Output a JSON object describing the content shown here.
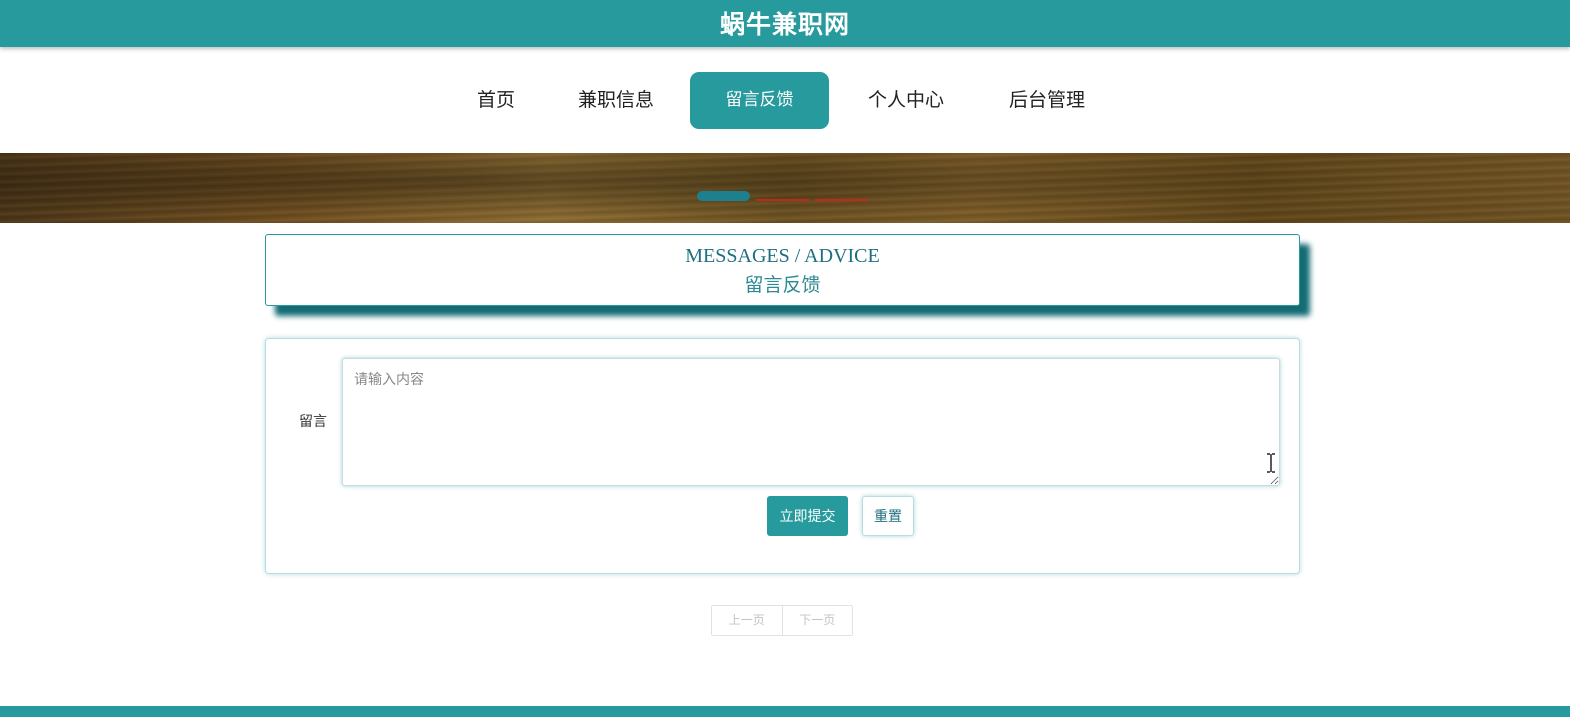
{
  "site": {
    "title": "蜗牛兼职网"
  },
  "nav": {
    "items": [
      {
        "label": "首页",
        "active": false
      },
      {
        "label": "兼职信息",
        "active": false
      },
      {
        "label": "留言反馈",
        "active": true
      },
      {
        "label": "个人中心",
        "active": false
      },
      {
        "label": "后台管理",
        "active": false
      }
    ]
  },
  "carousel": {
    "slide_count": 3,
    "active_index": 0
  },
  "section": {
    "title_en": "MESSAGES / ADVICE",
    "title_cn": "留言反馈"
  },
  "form": {
    "label": "留言",
    "textarea": {
      "value": "",
      "placeholder": "请输入内容"
    },
    "submit_label": "立即提交",
    "reset_label": "重置"
  },
  "pagination": {
    "prev_label": "上一页",
    "next_label": "下一页"
  },
  "colors": {
    "primary": "#269a9c",
    "title_text": "#1e6f80",
    "carousel_inactive": "#c0281e"
  }
}
